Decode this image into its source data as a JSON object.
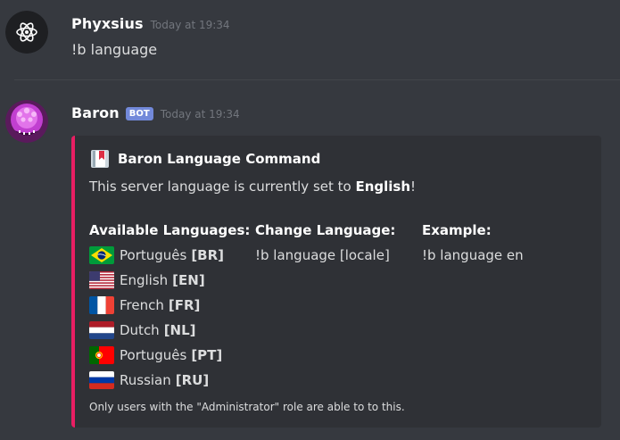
{
  "messages": [
    {
      "username": "Phyxsius",
      "timestamp": "Today at 19:34",
      "text": "!b language"
    },
    {
      "username": "Baron",
      "bot_tag": "BOT",
      "timestamp": "Today at 19:34",
      "embed": {
        "accent_color": "#e91e63",
        "author_icon": "book-icon",
        "author_name": "Baron Language Command",
        "description_prefix": "This server language is currently set to ",
        "description_bold": "English",
        "description_suffix": "!",
        "fields": [
          {
            "name": "Available Languages:",
            "languages": [
              {
                "flag": "brazil-flag-icon",
                "name": "Português",
                "code": "[BR]"
              },
              {
                "flag": "us-flag-icon",
                "name": "English",
                "code": "[EN]"
              },
              {
                "flag": "france-flag-icon",
                "name": "French",
                "code": "[FR]"
              },
              {
                "flag": "netherlands-flag-icon",
                "name": "Dutch",
                "code": "[NL]"
              },
              {
                "flag": "portugal-flag-icon",
                "name": "Português",
                "code": "[PT]"
              },
              {
                "flag": "russia-flag-icon",
                "name": "Russian",
                "code": "[RU]"
              }
            ]
          },
          {
            "name": "Change Language:",
            "value": "!b language [locale]"
          },
          {
            "name": "Example:",
            "value": "!b language en"
          }
        ],
        "footer": "Only users with the \"Administrator\" role are able to to this."
      }
    }
  ],
  "colors": {
    "background": "#36393f",
    "embed_background": "#2f3136",
    "bot_tag": "#7289da"
  }
}
